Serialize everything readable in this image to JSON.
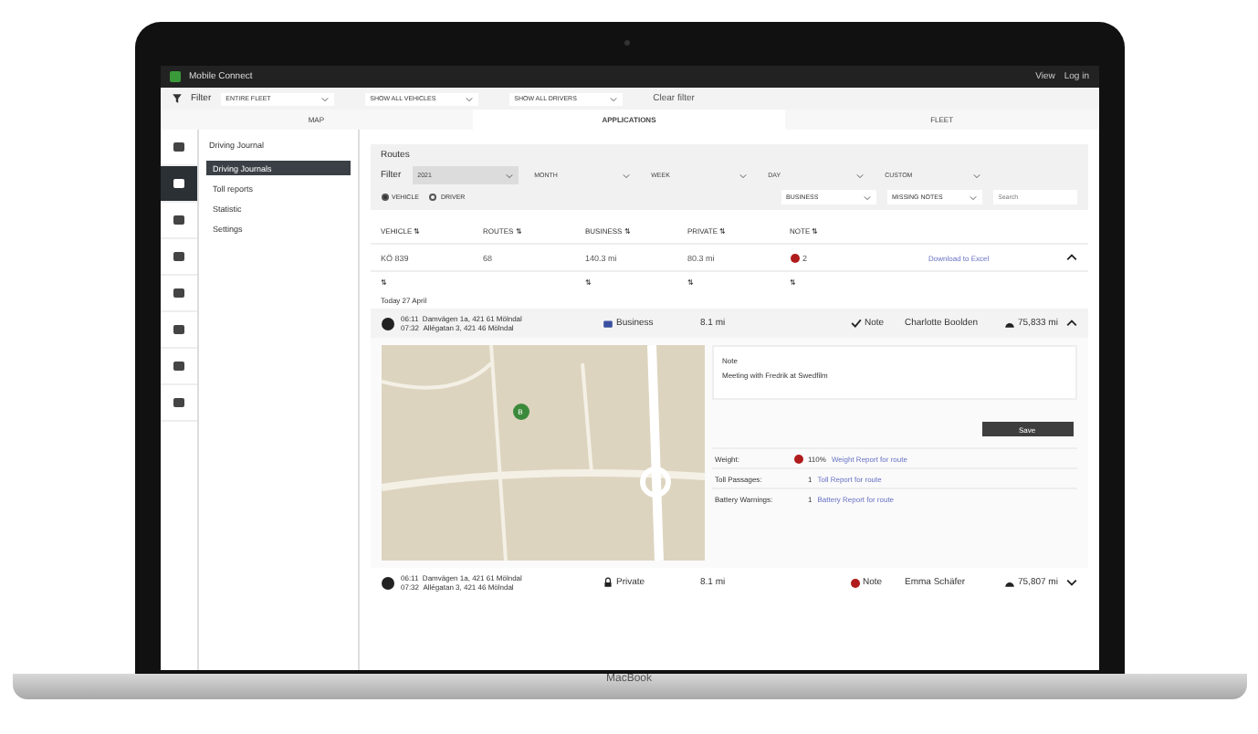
{
  "app": {
    "logo": "Mobile Connect",
    "links": [
      "View",
      "Log in"
    ]
  },
  "filter_bar": {
    "label": "Filter",
    "dropdowns": [
      "ENTIRE FLEET",
      "SHOW ALL VEHICLES",
      "SHOW ALL DRIVERS"
    ],
    "clear": "Clear filter"
  },
  "tabs": [
    {
      "label": "MAP",
      "selected": false
    },
    {
      "label": "APPLICATIONS",
      "selected": true
    },
    {
      "label": "FLEET",
      "selected": false
    }
  ],
  "rail": [
    {
      "selected": false
    },
    {
      "selected": true
    },
    {
      "selected": false
    },
    {
      "selected": false
    },
    {
      "selected": false
    },
    {
      "selected": false
    },
    {
      "selected": false
    },
    {
      "selected": false
    }
  ],
  "sidebar": {
    "title": "Driving Journal",
    "items": [
      {
        "label": "Driving Journals",
        "selected": true
      },
      {
        "label": "Toll reports",
        "selected": false
      },
      {
        "label": "Statistic",
        "selected": false
      },
      {
        "label": "Settings",
        "selected": false
      }
    ]
  },
  "routes": {
    "title": "Routes",
    "filter": "Filter",
    "periods": [
      {
        "label": "2021",
        "selected": true
      },
      {
        "label": "MONTH",
        "selected": false
      },
      {
        "label": "WEEK",
        "selected": false
      },
      {
        "label": "DAY",
        "selected": false
      },
      {
        "label": "CUSTOM",
        "selected": false
      }
    ],
    "radios": [
      {
        "label": "VEHICLE",
        "selected": true
      },
      {
        "label": "DRIVER",
        "selected": false
      }
    ],
    "selects": [
      "BUSINESS",
      "MISSING NOTES"
    ],
    "search": {
      "placeholder": "Search"
    }
  },
  "table": {
    "columns": [
      "VEHICLE",
      "ROUTES",
      "BUSINESS",
      "PRIVATE",
      "NOTE"
    ],
    "sort_icon": "⇅",
    "row": {
      "vehicle": "KÖ 839",
      "routes": "68",
      "business": "140.3 mi",
      "private": "80.3 mi",
      "notes": "2",
      "download": "Download to Excel",
      "expanded": true
    }
  },
  "day": "Today 27 April",
  "trips": [
    {
      "kind": "business",
      "times": [
        "06:11",
        "07:32"
      ],
      "addresses": [
        "Damvägen 1a, 421 61 Mölndal",
        "Allégatan 3, 421 46 Mölndal"
      ],
      "type": "Business",
      "distance": "8.1 mi",
      "note_ok": true,
      "note": "Note",
      "driver": "Charlotte Boolden",
      "odometer": "75,833 mi",
      "expanded": true,
      "detail": {
        "marker": "B",
        "note_label": "Note",
        "note_text": "Meeting with Fredrik at Swedfilm",
        "save": "Save",
        "facts": [
          {
            "label": "Weight:",
            "value": "110%",
            "warning": true,
            "link": "Weight Report for route"
          },
          {
            "label": "Toll Passages:",
            "value": "1",
            "warning": false,
            "link": "Toll Report for route"
          },
          {
            "label": "Battery Warnings:",
            "value": "1",
            "warning": false,
            "link": "Battery Report for route"
          }
        ]
      }
    },
    {
      "kind": "private",
      "times": [
        "06:11",
        "07:32"
      ],
      "addresses": [
        "Damvägen 1a, 421 61 Mölndal",
        "Allégatan 3, 421 46 Mölndal"
      ],
      "type": "Private",
      "distance": "8.1 mi",
      "note_ok": false,
      "note": "Note",
      "driver": "Emma Schäfer",
      "odometer": "75,807 mi",
      "expanded": false
    }
  ],
  "device": {
    "label": "MacBook"
  }
}
